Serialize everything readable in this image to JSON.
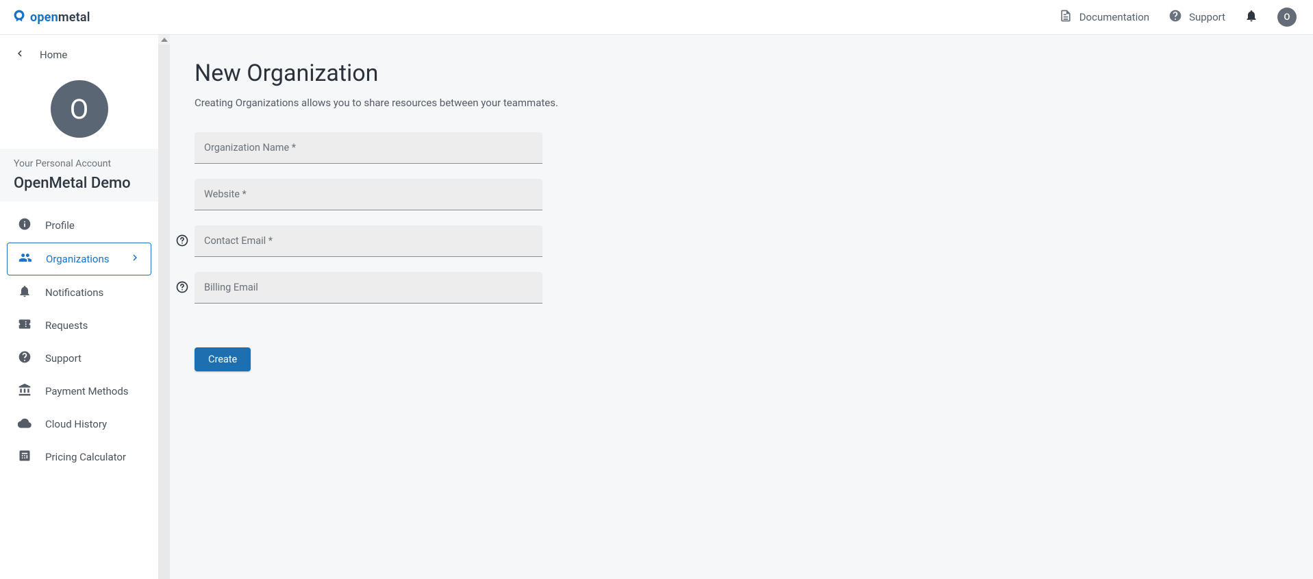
{
  "header": {
    "brand_open": "open",
    "brand_metal": "metal",
    "documentation": "Documentation",
    "support": "Support",
    "notifications": "Notifications",
    "avatar_initial": "O"
  },
  "sidebar": {
    "back_label": "Home",
    "avatar_initial": "O",
    "account_sub": "Your Personal Account",
    "account_name": "OpenMetal Demo",
    "nav": {
      "profile": "Profile",
      "organizations": "Organizations",
      "notifications": "Notifications",
      "requests": "Requests",
      "support": "Support",
      "payment_methods": "Payment Methods",
      "cloud_history": "Cloud History",
      "pricing_calculator": "Pricing Calculator"
    }
  },
  "page": {
    "title": "New Organization",
    "desc": "Creating Organizations allows you to share resources between your teammates.",
    "fields": {
      "org_name": "Organization Name *",
      "website": "Website *",
      "contact_email": "Contact Email *",
      "billing_email": "Billing Email"
    },
    "create_btn": "Create"
  }
}
